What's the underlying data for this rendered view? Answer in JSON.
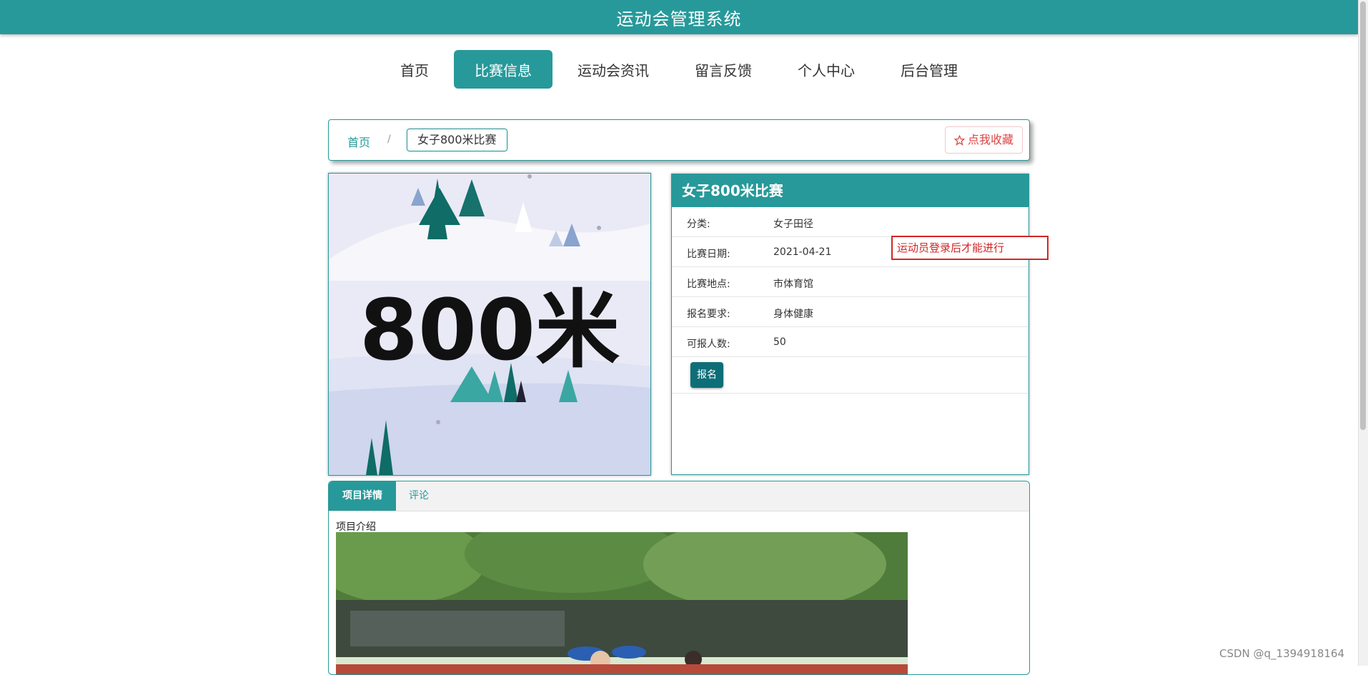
{
  "header": {
    "title": "运动会管理系统"
  },
  "nav": {
    "items": [
      {
        "label": "首页",
        "active": false
      },
      {
        "label": "比赛信息",
        "active": true
      },
      {
        "label": "运动会资讯",
        "active": false
      },
      {
        "label": "留言反馈",
        "active": false
      },
      {
        "label": "个人中心",
        "active": false
      },
      {
        "label": "后台管理",
        "active": false
      }
    ]
  },
  "breadcrumb": {
    "home": "首页",
    "sep": "/",
    "current": "女子800米比赛"
  },
  "favorite": {
    "icon": "star-outline-icon",
    "label": "点我收藏"
  },
  "poster": {
    "text": "800米"
  },
  "detail": {
    "title": "女子800米比赛",
    "rows": [
      {
        "label": "分类:",
        "value": "女子田径"
      },
      {
        "label": "比赛日期:",
        "value": "2021-04-21"
      },
      {
        "label": "比赛地点:",
        "value": "市体育馆"
      },
      {
        "label": "报名要求:",
        "value": "身体健康"
      },
      {
        "label": "可报人数:",
        "value": "50"
      }
    ],
    "signup_label": "报名"
  },
  "tooltip": {
    "text": "运动员登录后才能进行"
  },
  "tabs": {
    "items": [
      {
        "label": "项目详情"
      },
      {
        "label": "评论"
      }
    ],
    "intro": "项目介绍"
  },
  "watermark": "CSDN @q_1394918164",
  "colors": {
    "primary": "#27999a",
    "dark_button": "#0e6e78",
    "tip_red": "#d32525"
  }
}
